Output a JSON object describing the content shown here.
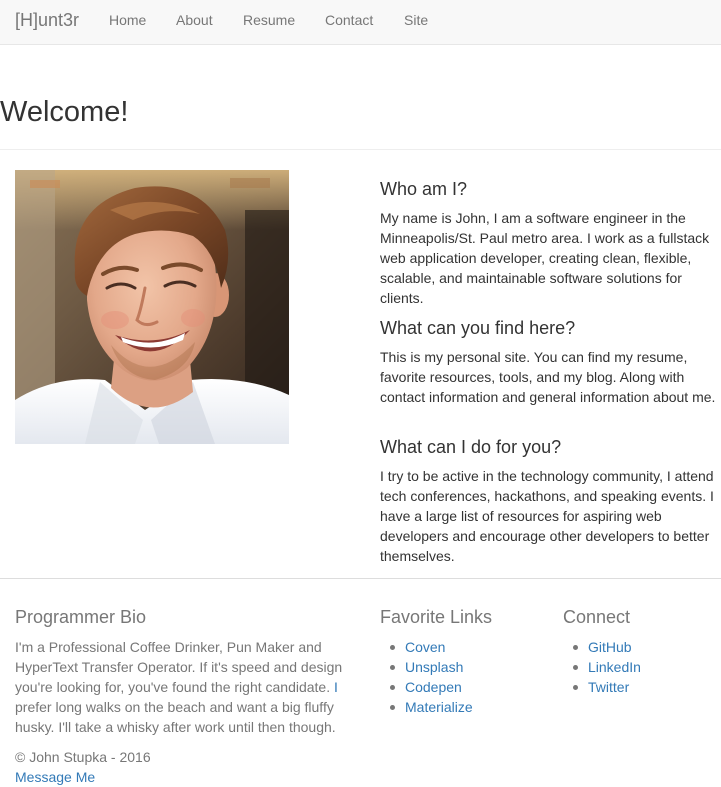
{
  "navbar": {
    "brand": "[H]unt3r",
    "items": [
      {
        "label": "Home"
      },
      {
        "label": "About"
      },
      {
        "label": "Resume"
      },
      {
        "label": "Contact"
      },
      {
        "label": "Site"
      }
    ]
  },
  "page": {
    "title": "Welcome!"
  },
  "about": {
    "sections": [
      {
        "heading": "Who am I?",
        "text": "My name is John, I am a software engineer in the Minneapolis/St. Paul metro area. I work as a fullstack web application developer, creating clean, flexible, scalable, and maintainable software solutions for clients."
      },
      {
        "heading": "What can you find here?",
        "text": "This is my personal site. You can find my resume, favorite resources, tools, and my blog. Along with contact information and general information about me."
      },
      {
        "heading": "What can I do for you?",
        "text": "I try to be active in the technology community, I attend tech conferences, hackathons, and speaking events. I have a large list of resources for aspiring web developers and encourage other developers to better themselves."
      }
    ]
  },
  "footer": {
    "bio": {
      "heading": "Programmer Bio",
      "text_before": "I'm a Professional Coffee Drinker, Pun Maker and HyperText Transfer Operator. If it's speed and design you're looking for, you've found the right candidate. ",
      "text_highlight": "I",
      "text_after": " prefer long walks on the beach and want a big fluffy husky. I'll take a whisky after work until then though.",
      "copyright": "© John Stupka - 2016",
      "message_link": "Message Me"
    },
    "favorite_links": {
      "heading": "Favorite Links",
      "items": [
        {
          "label": "Coven"
        },
        {
          "label": "Unsplash"
        },
        {
          "label": "Codepen"
        },
        {
          "label": "Materialize"
        }
      ]
    },
    "connect": {
      "heading": "Connect",
      "items": [
        {
          "label": "GitHub"
        },
        {
          "label": "LinkedIn"
        },
        {
          "label": "Twitter"
        }
      ]
    }
  },
  "colors": {
    "navbar_bg": "#f8f8f8",
    "link": "#337ab7",
    "muted_text": "#777777",
    "body_text": "#333333"
  }
}
